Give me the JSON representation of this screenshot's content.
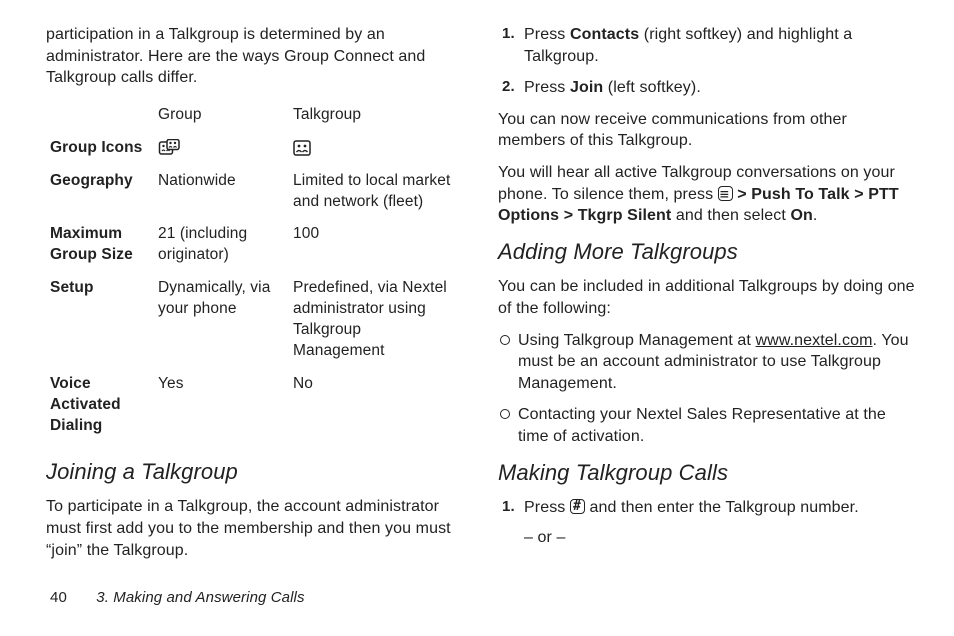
{
  "left_intro": "participation in a Talkgroup is determined by an administrator. Here are the ways Group Connect and Talkgroup calls differ.",
  "table": {
    "col_group": "Group",
    "col_talkgroup": "Talkgroup",
    "rows": {
      "icons": {
        "label": "Group Icons"
      },
      "geo": {
        "label": "Geography",
        "group": "Nationwide",
        "talk": "Limited to local market and network (fleet)"
      },
      "size": {
        "label": "Maximum Group Size",
        "group": "21 (including originator)",
        "talk": "100"
      },
      "setup": {
        "label": "Setup",
        "group": "Dynamically, via your phone",
        "talk": "Predefined, via Nextel administrator using Talkgroup Management"
      },
      "vad": {
        "label": "Voice Activated Dialing",
        "group": "Yes",
        "talk": "No"
      }
    }
  },
  "joining": {
    "heading": "Joining a Talkgroup",
    "body": "To participate in a Talkgroup, the account administrator must first add you to the membership and then you must “join” the Talkgroup."
  },
  "steps": {
    "s1a": "Press ",
    "s1b": "Contacts",
    "s1c": " (right softkey) and highlight a Talkgroup.",
    "s2a": "Press ",
    "s2b": "Join",
    "s2c": " (left softkey)."
  },
  "after_steps": "You can now receive communications from other members of this Talkgroup.",
  "silence": {
    "pre": "You will hear all active Talkgroup conversations on your phone. To silence them, press ",
    "ptt": "Push To Talk",
    "pttopt": "PTT Options",
    "tkgrp": "Tkgrp Silent",
    "mid": " and then select ",
    "on": "On",
    "dot": "."
  },
  "adding": {
    "heading": "Adding More Talkgroups",
    "intro": "You can be included in additional Talkgroups by doing one of the following:",
    "b1a": "Using Talkgroup Management at ",
    "b1link": "www.nextel.com",
    "b1b": ". You must be an account administrator to use Talkgroup Management.",
    "b2": "Contacting your Nextel Sales Representative at the time of activation."
  },
  "making": {
    "heading": "Making Talkgroup Calls",
    "s1a": "Press ",
    "s1b": " and then enter the Talkgroup number.",
    "or": "– or –"
  },
  "footer": {
    "page": "40",
    "chapter": "3. Making and Answering Calls"
  },
  "glyph": {
    "gt": ">"
  }
}
